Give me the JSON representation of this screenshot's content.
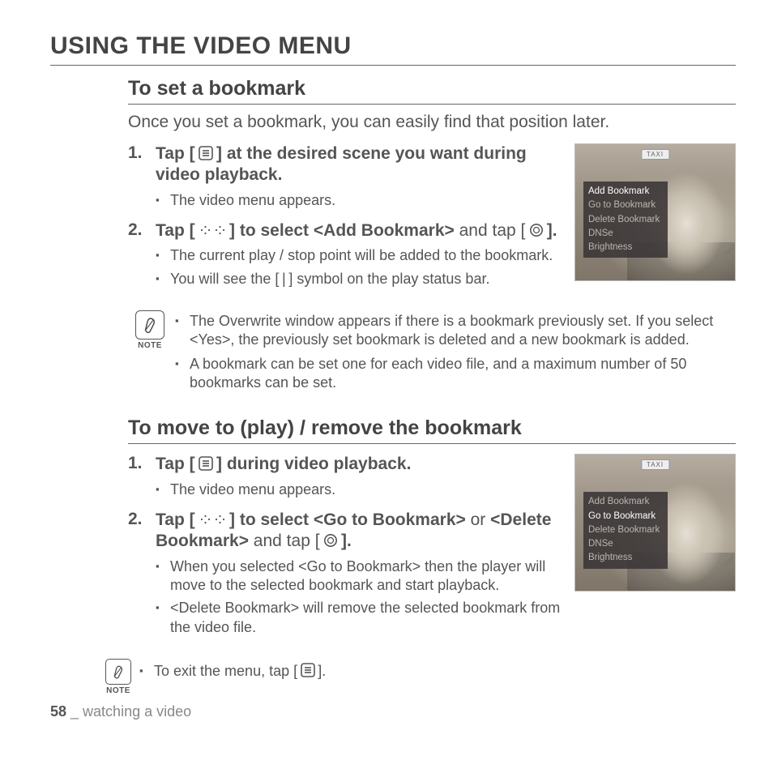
{
  "mainTitle": "USING THE VIDEO MENU",
  "noteLabel": "NOTE",
  "sectionA": {
    "title": "To set a bookmark",
    "intro": "Once you set a bookmark, you can easily find that position later.",
    "step1": {
      "num": "1.",
      "preIcon": "Tap [ ",
      "postIcon": " ] at the desired scene you want during video playback."
    },
    "step1_bul1": "The video menu appears.",
    "step2": {
      "num": "2.",
      "t1": "Tap [ ",
      "t2": " ] to select ",
      "bold1": "<Add Bookmark>",
      "t3": " and tap [ ",
      "t4": " ].",
      "bul1": "The current play / stop point will be added to the bookmark.",
      "bul2_pre": "You will see the [ ",
      "bul2_mark": "|",
      "bul2_post": " ] symbol on the play status bar."
    },
    "menu": {
      "taxi": "TAXI",
      "m1": "Add Bookmark",
      "m2": "Go to Bookmark",
      "m3": "Delete Bookmark",
      "m4": "DNSe",
      "m5": "Brightness",
      "selectedIndex": 0
    },
    "note1": "The Overwrite window appears if there is a bookmark previously set. If you select <Yes>, the previously set bookmark is deleted and a new bookmark is added.",
    "note2": "A bookmark can be set one for each video file, and a maximum number of 50 bookmarks can be set."
  },
  "sectionB": {
    "title": "To move to (play) / remove the bookmark",
    "step1": {
      "num": "1.",
      "preIcon": "Tap [ ",
      "postIcon": " ] during video playback."
    },
    "step1_bul1": "The video menu appears.",
    "step2": {
      "num": "2.",
      "t1": "Tap [ ",
      "t2": " ] to select ",
      "bold1": "<Go to Bookmark>",
      "t3": " or ",
      "bold2": "<Delete Bookmark>",
      "t4": " and tap [ ",
      "t5": " ].",
      "bul1": "When you selected <Go to Bookmark> then the player will move to the selected bookmark and start playback.",
      "bul2": "<Delete Bookmark> will remove the selected bookmark from the video file."
    },
    "menu": {
      "taxi": "TAXI",
      "m1": "Add Bookmark",
      "m2": "Go to Bookmark",
      "m3": "Delete Bookmark",
      "m4": "DNSe",
      "m5": "Brightness",
      "selectedIndex": 1
    },
    "note1_pre": "To exit the menu, tap [ ",
    "note1_post": " ]."
  },
  "footer": {
    "page": "58",
    "sep": " _ ",
    "section": "watching a video"
  }
}
